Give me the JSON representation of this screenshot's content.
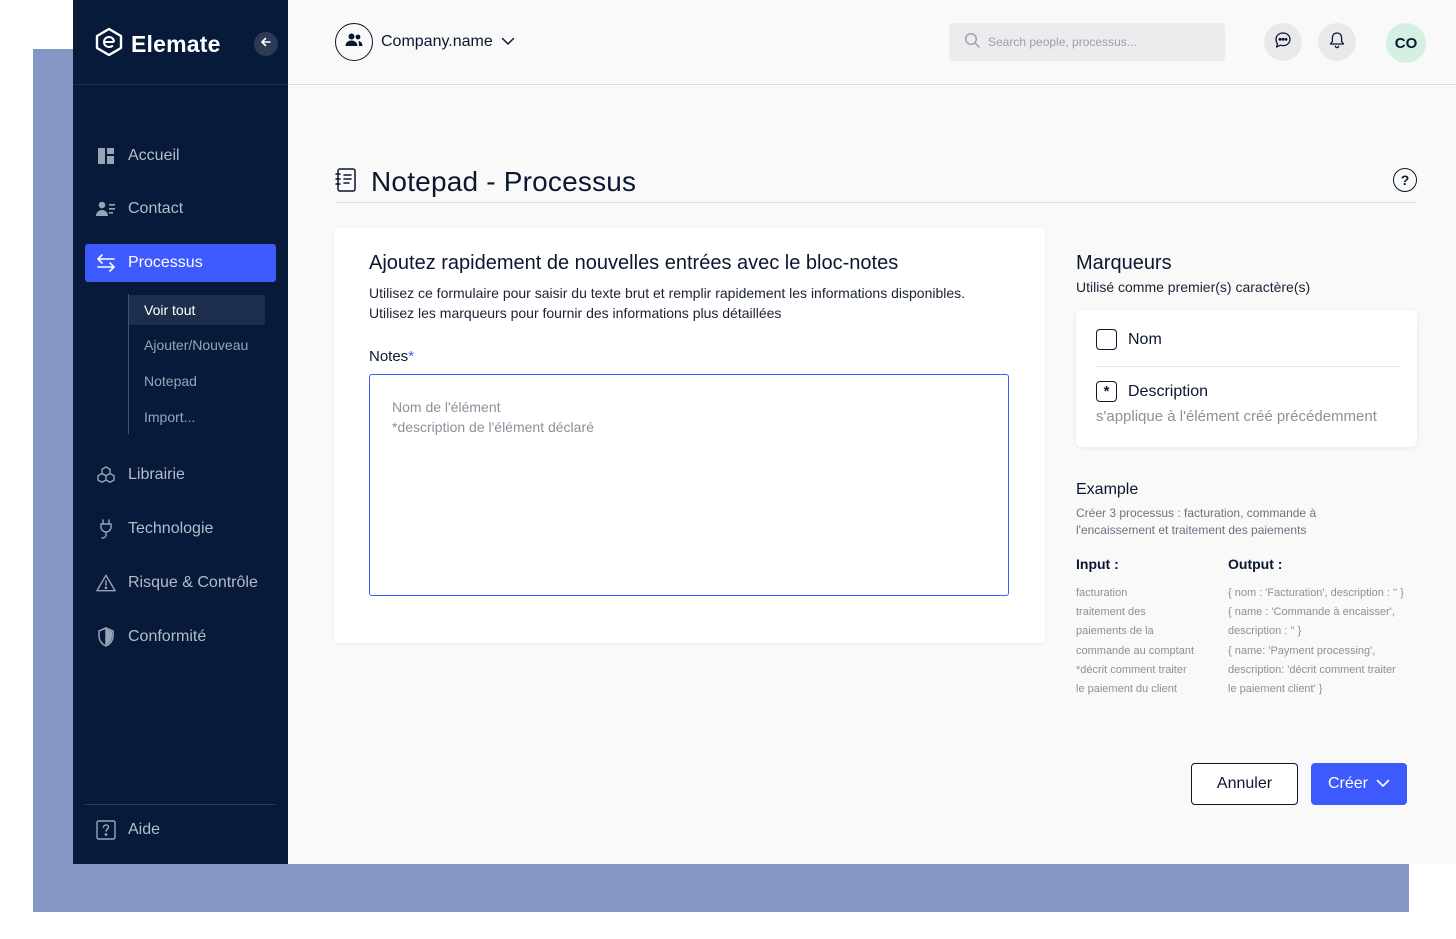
{
  "colors": {
    "sidebar_bg": "#071a3a",
    "accent": "#3d5afe",
    "backdrop": "#8496c3"
  },
  "brand": {
    "name": "Elemate",
    "logo_icon": "elemate-logo-icon"
  },
  "sidebar": {
    "collapse_icon": "arrow-left-icon",
    "items": [
      {
        "label": "Accueil",
        "icon": "dashboard-icon"
      },
      {
        "label": "Contact",
        "icon": "contacts-icon"
      },
      {
        "label": "Processus",
        "icon": "swap-arrows-icon",
        "active": true
      },
      {
        "label": "Librairie",
        "icon": "cubes-icon"
      },
      {
        "label": "Technologie",
        "icon": "plug-icon"
      },
      {
        "label": "Risque & Contrôle",
        "icon": "warning-icon"
      },
      {
        "label": "Conformité",
        "icon": "shield-icon"
      }
    ],
    "subitems": [
      {
        "label": "Voir tout",
        "active": true
      },
      {
        "label": "Ajouter/Nouveau"
      },
      {
        "label": "Notepad"
      },
      {
        "label": "Import..."
      }
    ],
    "help": {
      "label": "Aide",
      "icon": "question-square-icon"
    }
  },
  "header": {
    "company": "Company.name",
    "search_placeholder": "Search people, processus...",
    "user_initials": "CO"
  },
  "page": {
    "title": "Notepad - Processus"
  },
  "form": {
    "heading": "Ajoutez rapidement de nouvelles entrées avec le bloc-notes",
    "desc_line1": "Utilisez ce formulaire pour saisir du texte brut et remplir rapidement les informations disponibles.",
    "desc_line2": "Utilisez les marqueurs pour fournir des informations plus détaillées",
    "notes_label": "Notes",
    "required_mark": "*",
    "notes_placeholder": "Nom de l'élément\n*description de l'élément déclaré",
    "notes_value": ""
  },
  "markers": {
    "title": "Marqueurs",
    "subtitle": "Utilisé comme premier(s) caractère(s)",
    "items": [
      {
        "symbol": "",
        "label": "Nom"
      },
      {
        "symbol": "*",
        "label": "Description"
      }
    ],
    "hint": "s'applique à l'élément créé précédemment"
  },
  "example": {
    "title": "Example",
    "desc": "Créer 3 processus : facturation, commande à l'encaissement et traitement des paiements",
    "input_title": "Input :",
    "output_title": "Output :",
    "input_lines": [
      "facturation",
      "traitement des",
      "paiements de la",
      "commande au comptant",
      "*décrit comment traiter",
      "le paiement du client"
    ],
    "output_lines": [
      "{ nom : 'Facturation', description : '' }",
      "{ name : 'Commande à encaisser',",
      "description : '' }",
      "{ name: 'Payment processing',",
      "description: 'décrit comment traiter",
      "le paiement client' }"
    ]
  },
  "actions": {
    "cancel": "Annuler",
    "create": "Créer"
  }
}
